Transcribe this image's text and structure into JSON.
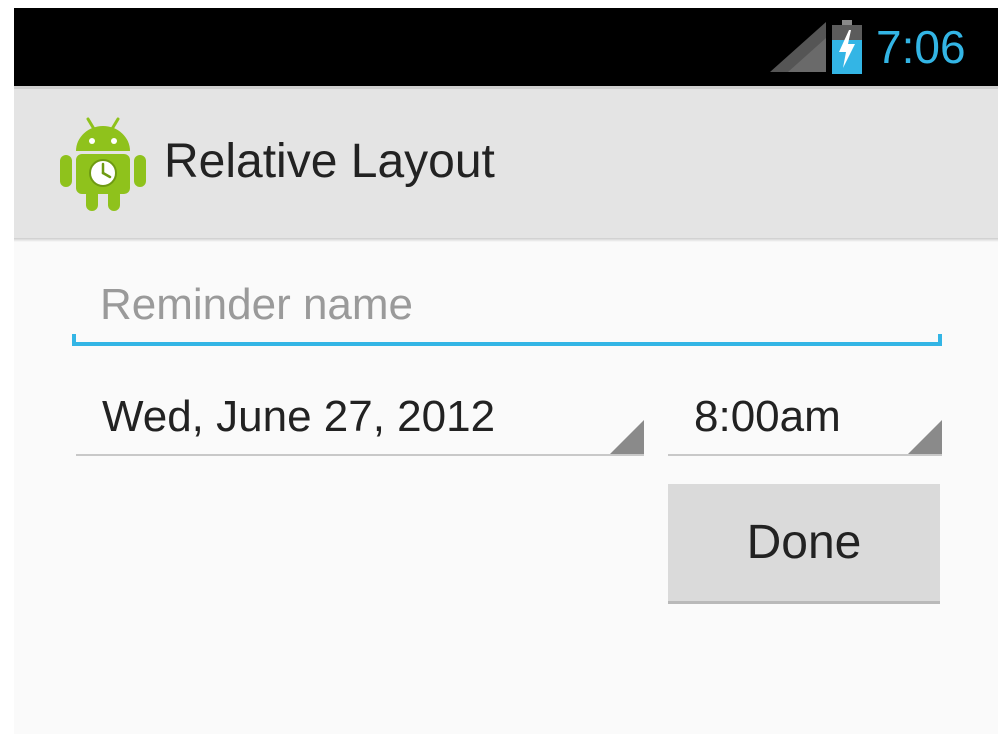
{
  "status_bar": {
    "time": "7:06",
    "signal_icon": "signal-strength-icon",
    "battery_icon": "battery-charging-icon",
    "accent_color": "#33b5e5"
  },
  "action_bar": {
    "app_icon": "android-robot-icon",
    "title": "Relative Layout"
  },
  "form": {
    "reminder_name": {
      "value": "",
      "placeholder": "Reminder name"
    },
    "date": {
      "selected": "Wed, June 27, 2012"
    },
    "time": {
      "selected": "8:00am"
    },
    "done_label": "Done"
  }
}
